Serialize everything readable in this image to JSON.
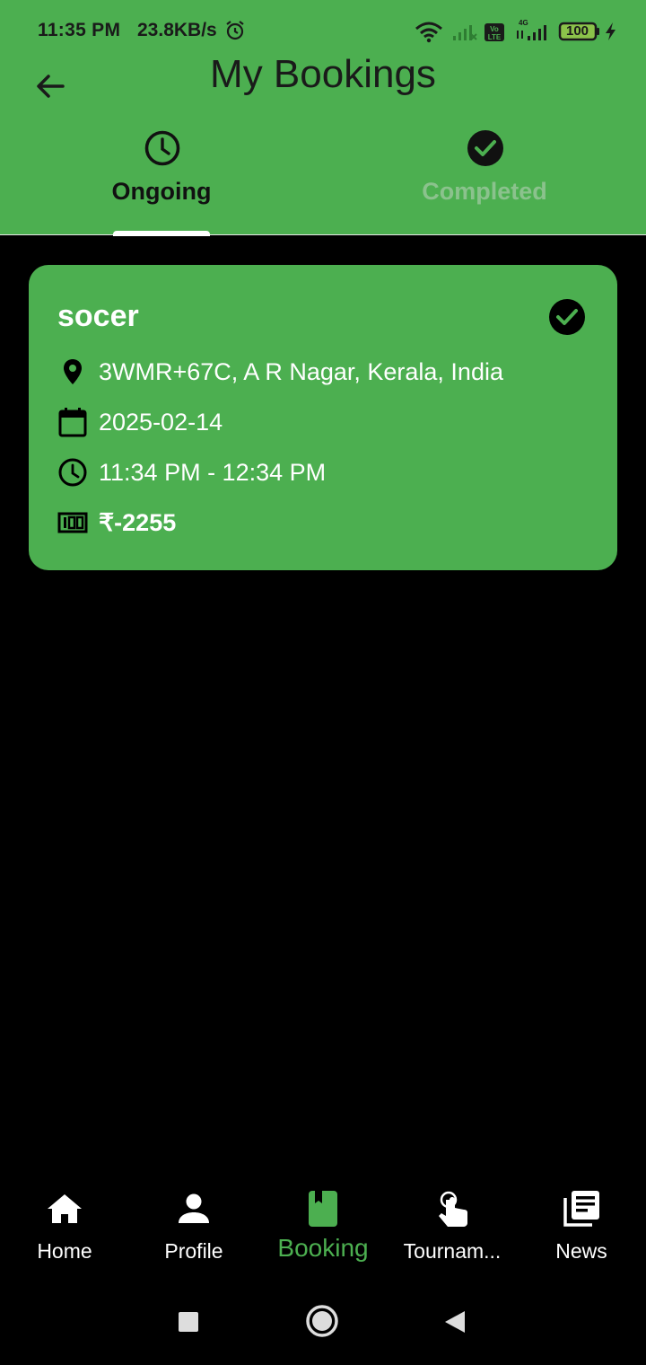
{
  "status_bar": {
    "time": "11:35 PM",
    "net_speed": "23.8KB/s",
    "battery": "100"
  },
  "header": {
    "title": "My Bookings",
    "back_icon": "arrow-back-icon"
  },
  "tabs": [
    {
      "label": "Ongoing",
      "icon": "clock-icon",
      "active": true
    },
    {
      "label": "Completed",
      "icon": "check-circle-icon",
      "active": false
    }
  ],
  "booking": {
    "name": "socer",
    "status_icon": "check-circle-icon",
    "location": "3WMR+67C, A R Nagar, Kerala, India",
    "date": "2025-02-14",
    "time": "11:34 PM - 12:34 PM",
    "price": "₹-2255"
  },
  "bottom_nav": [
    {
      "label": "Home",
      "icon": "home-icon",
      "active": false
    },
    {
      "label": "Profile",
      "icon": "person-icon",
      "active": false
    },
    {
      "label": "Booking",
      "icon": "book-icon",
      "active": true
    },
    {
      "label": "Tournam...",
      "icon": "touch-icon",
      "active": false
    },
    {
      "label": "News",
      "icon": "news-icon",
      "active": false
    }
  ],
  "colors": {
    "primary": "#4caf50",
    "background": "#000000",
    "text_dark": "#1a1a1a",
    "text_light": "#ffffff"
  }
}
